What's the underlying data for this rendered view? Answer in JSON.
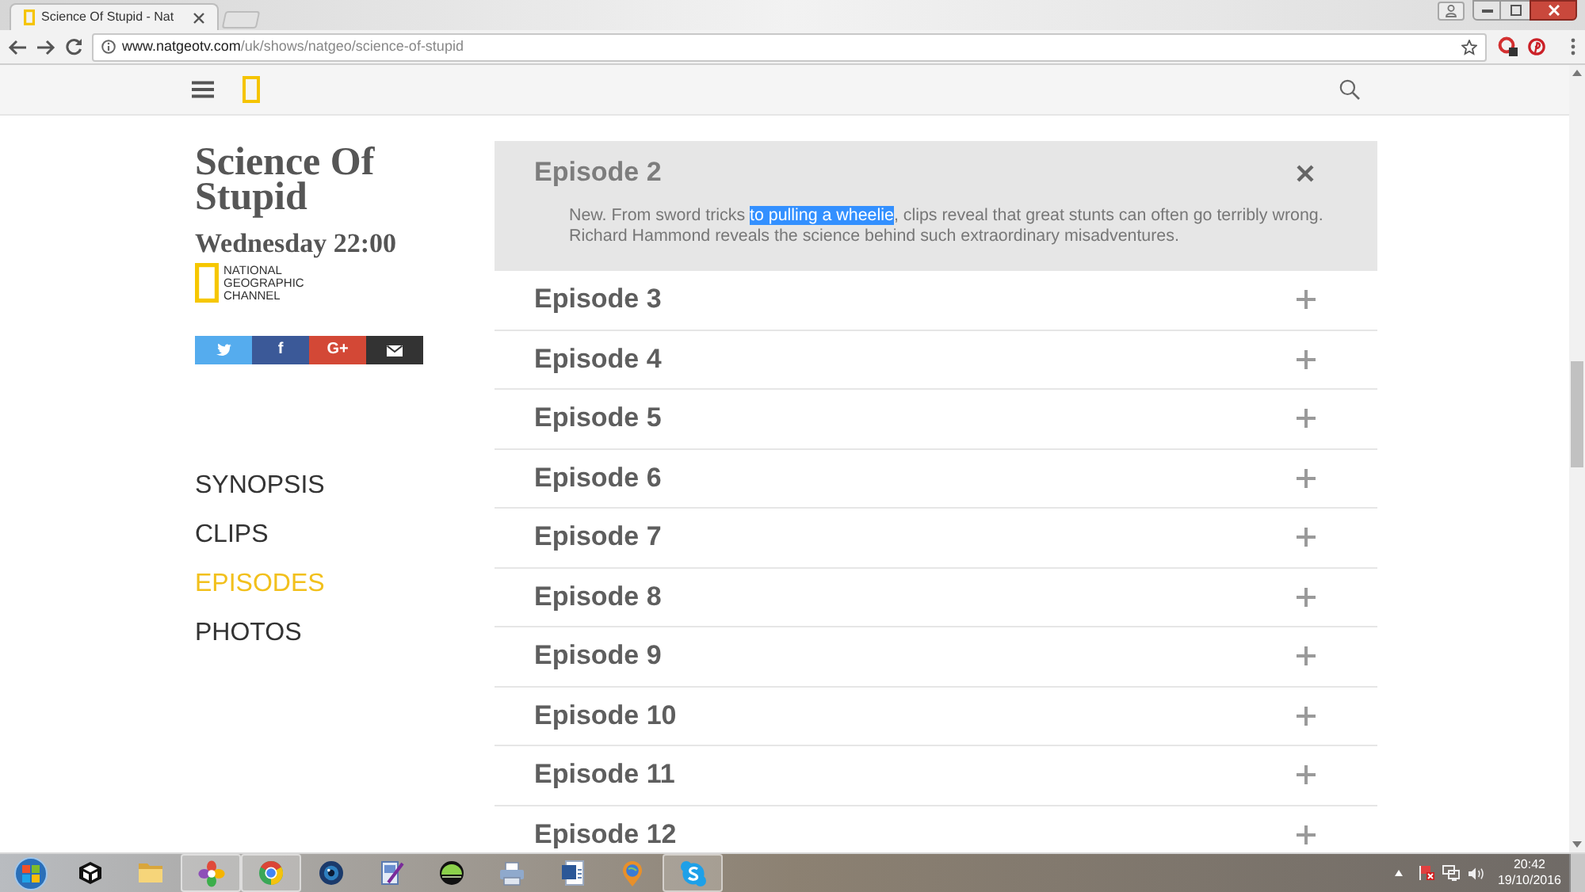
{
  "browser": {
    "tab_title": "Science Of Stupid - Nat",
    "url_host": "www.natgeotv.com",
    "url_path": "/uk/shows/natgeo/science-of-stupid"
  },
  "show": {
    "title": "Science Of Stupid",
    "schedule": "Wednesday 22:00",
    "channel_logo_lines": [
      "NATIONAL",
      "GEOGRAPHIC",
      "CHANNEL"
    ],
    "share_buttons": [
      {
        "kind": "bird",
        "color": "#55acee"
      },
      {
        "kind": "text",
        "label": "f",
        "color": "#3b5998"
      },
      {
        "kind": "text",
        "label": "G+",
        "color": "#d34836"
      },
      {
        "kind": "envelope",
        "color": "#333333"
      }
    ]
  },
  "nav": [
    {
      "label": "SYNOPSIS",
      "selected": false
    },
    {
      "label": "CLIPS",
      "selected": false
    },
    {
      "label": "EPISODES",
      "selected": true
    },
    {
      "label": "PHOTOS",
      "selected": false
    }
  ],
  "episodes": [
    {
      "title": "Episode 2",
      "expanded": true,
      "description": [
        {
          "text": "New. From sword tricks ",
          "highlighted": false
        },
        {
          "text": "to pulling a wheelie",
          "highlighted": true
        },
        {
          "text": ", clips reveal that great stunts can often go terribly wrong. Richard Hammond reveals the science behind such extraordinary misadventures.",
          "highlighted": false
        }
      ]
    },
    {
      "title": "Episode 3",
      "expanded": false
    },
    {
      "title": "Episode 4",
      "expanded": false
    },
    {
      "title": "Episode 5",
      "expanded": false
    },
    {
      "title": "Episode 6",
      "expanded": false
    },
    {
      "title": "Episode 7",
      "expanded": false
    },
    {
      "title": "Episode 8",
      "expanded": false
    },
    {
      "title": "Episode 9",
      "expanded": false
    },
    {
      "title": "Episode 10",
      "expanded": false
    },
    {
      "title": "Episode 11",
      "expanded": false
    },
    {
      "title": "Episode 12",
      "expanded": false
    }
  ],
  "taskbar": {
    "apps": [
      {
        "kind": "cube",
        "running": false
      },
      {
        "kind": "folder",
        "running": false
      },
      {
        "kind": "pinwheel",
        "running": true
      },
      {
        "kind": "ring",
        "running": true
      },
      {
        "kind": "lens",
        "running": false
      },
      {
        "kind": "document-pen",
        "running": false
      },
      {
        "kind": "dome",
        "running": false
      },
      {
        "kind": "printer",
        "running": false
      },
      {
        "kind": "document",
        "running": false
      },
      {
        "kind": "globe-pin",
        "running": false
      },
      {
        "kind": "cloud",
        "running": true
      }
    ],
    "time": "20:42",
    "date": "19/10/2016"
  }
}
